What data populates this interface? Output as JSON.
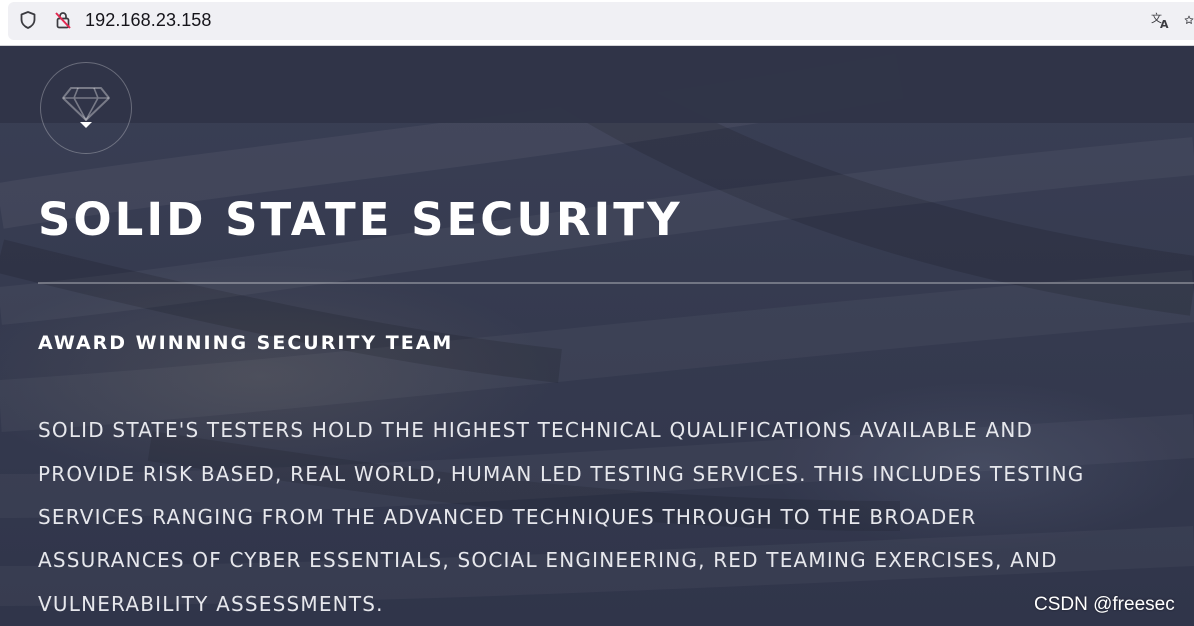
{
  "browser": {
    "url": "192.168.23.158",
    "icons": {
      "tracking": "shield-icon",
      "security": "insecure-lock-icon",
      "translate": "translate-icon",
      "bookmark": "star-icon"
    }
  },
  "site": {
    "logo_icon": "diamond-icon",
    "title": "SOLID STATE SECURITY",
    "subtitle": "AWARD WINNING SECURITY TEAM",
    "description_lines": [
      "SOLID STATE'S TESTERS HOLD THE HIGHEST TECHNICAL QUALIFICATIONS AVAILABLE AND",
      "PROVIDE RISK BASED, REAL WORLD, HUMAN LED TESTING SERVICES. THIS INCLUDES TESTING",
      "SERVICES RANGING FROM THE ADVANCED TECHNIQUES THROUGH TO THE BROADER",
      "ASSURANCES OF CYBER ESSENTIALS, SOCIAL ENGINEERING, RED TEAMING EXERCISES, AND",
      "VULNERABILITY ASSESSMENTS."
    ]
  },
  "watermark": "CSDN @freesec",
  "colors": {
    "background": "#363b50",
    "nav": "#303448",
    "text": "#ffffff"
  }
}
